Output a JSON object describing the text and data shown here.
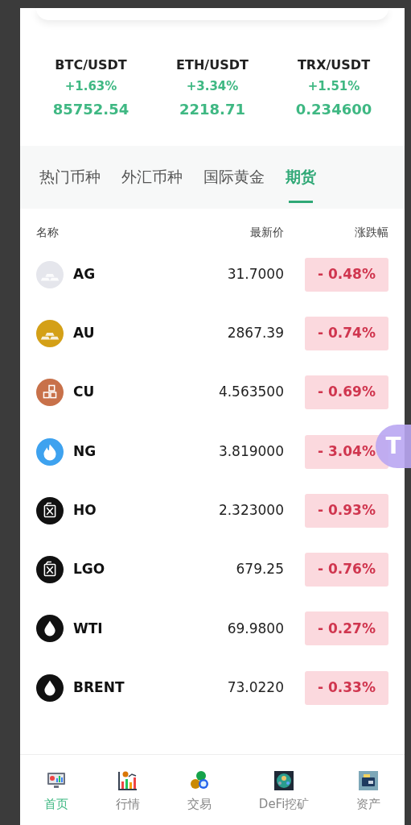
{
  "tickers": [
    {
      "pair": "BTC/USDT",
      "change": "+1.63%",
      "price": "85752.54"
    },
    {
      "pair": "ETH/USDT",
      "change": "+3.34%",
      "price": "2218.71"
    },
    {
      "pair": "TRX/USDT",
      "change": "+1.51%",
      "price": "0.234600"
    }
  ],
  "tabs": [
    {
      "label": "热门币种",
      "selected": false
    },
    {
      "label": "外汇币种",
      "selected": false
    },
    {
      "label": "国际黄金",
      "selected": false
    },
    {
      "label": "期货",
      "selected": true
    }
  ],
  "table": {
    "columns": [
      "名称",
      "最新价",
      "涨跌幅"
    ],
    "rows": [
      {
        "kind": "bars",
        "color": "#e5e6ec",
        "name": "AG",
        "price": "31.7000",
        "change": "- 0.48%"
      },
      {
        "kind": "bars",
        "color": "#d4a017",
        "name": "AU",
        "price": "2867.39",
        "change": "- 0.74%"
      },
      {
        "kind": "copper",
        "color": "#c8714a",
        "name": "CU",
        "price": "4.563500",
        "change": "- 0.69%"
      },
      {
        "kind": "flame",
        "color": "#3ea2ef",
        "name": "NG",
        "price": "3.819000",
        "change": "- 3.04%"
      },
      {
        "kind": "canister",
        "color": "#111111",
        "name": "HO",
        "price": "2.323000",
        "change": "- 0.93%"
      },
      {
        "kind": "canister",
        "color": "#111111",
        "name": "LGO",
        "price": "679.25",
        "change": "- 0.76%"
      },
      {
        "kind": "drop",
        "color": "#111111",
        "name": "WTI",
        "price": "69.9800",
        "change": "- 0.27%"
      },
      {
        "kind": "drop",
        "color": "#111111",
        "name": "BRENT",
        "price": "73.0220",
        "change": "- 0.33%"
      }
    ]
  },
  "floating_button": {
    "label": "T"
  },
  "bottom_nav": [
    {
      "label": "首页",
      "selected": true
    },
    {
      "label": "行情",
      "selected": false
    },
    {
      "label": "交易",
      "selected": false
    },
    {
      "label": "DeFi挖矿",
      "selected": false
    },
    {
      "label": "资产",
      "selected": false
    }
  ]
}
